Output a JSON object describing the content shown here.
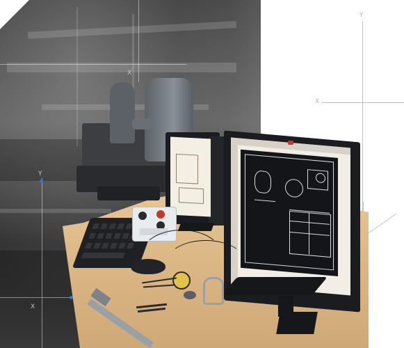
{
  "scene": {
    "description_free": true,
    "axis_labels": {
      "x_top_left": "X",
      "x_bottom_left": "X",
      "y_left": "Y",
      "x_right": "X",
      "y_right": "Y"
    },
    "colors": {
      "accent_dot": "#2a77d4",
      "guide_line": "#aab4be",
      "desk": "#dcb886",
      "cad_background": "#141518"
    },
    "icons": [
      "workshop-photo",
      "cmm-machine-icon",
      "monitor-icon",
      "keyboard-icon",
      "mouse-icon",
      "joystick-controller-icon",
      "caliper-icon",
      "dial-indicator-icon",
      "micrometer-icon"
    ]
  }
}
